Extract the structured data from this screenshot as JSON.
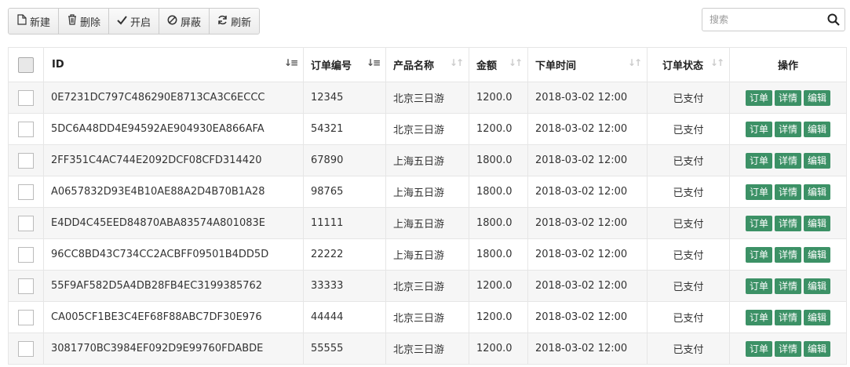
{
  "toolbar": {
    "buttons": [
      {
        "label": "新建",
        "icon": "file-icon"
      },
      {
        "label": "删除",
        "icon": "trash-icon"
      },
      {
        "label": "开启",
        "icon": "check-icon"
      },
      {
        "label": "屏蔽",
        "icon": "ban-icon"
      },
      {
        "label": "刷新",
        "icon": "refresh-icon"
      }
    ]
  },
  "search": {
    "placeholder": "搜索",
    "value": ""
  },
  "table": {
    "columns": [
      "ID",
      "订单编号",
      "产品名称",
      "金额",
      "下单时间",
      "订单状态",
      "操作"
    ],
    "actions": [
      "订单",
      "详情",
      "编辑"
    ],
    "rows": [
      {
        "id": "0E7231DC797C486290E8713CA3C6ECCC",
        "order_no": "12345",
        "product": "北京三日游",
        "amount": "1200.0",
        "time": "2018-03-02 12:00",
        "status": "已支付"
      },
      {
        "id": "5DC6A48DD4E94592AE904930EA866AFA",
        "order_no": "54321",
        "product": "北京三日游",
        "amount": "1200.0",
        "time": "2018-03-02 12:00",
        "status": "已支付"
      },
      {
        "id": "2FF351C4AC744E2092DCF08CFD314420",
        "order_no": "67890",
        "product": "上海五日游",
        "amount": "1800.0",
        "time": "2018-03-02 12:00",
        "status": "已支付"
      },
      {
        "id": "A0657832D93E4B10AE88A2D4B70B1A28",
        "order_no": "98765",
        "product": "上海五日游",
        "amount": "1800.0",
        "time": "2018-03-02 12:00",
        "status": "已支付"
      },
      {
        "id": "E4DD4C45EED84870ABA83574A801083E",
        "order_no": "11111",
        "product": "上海五日游",
        "amount": "1800.0",
        "time": "2018-03-02 12:00",
        "status": "已支付"
      },
      {
        "id": "96CC8BD43C734CC2ACBFF09501B4DD5D",
        "order_no": "22222",
        "product": "上海五日游",
        "amount": "1800.0",
        "time": "2018-03-02 12:00",
        "status": "已支付"
      },
      {
        "id": "55F9AF582D5A4DB28FB4EC3199385762",
        "order_no": "33333",
        "product": "北京三日游",
        "amount": "1200.0",
        "time": "2018-03-02 12:00",
        "status": "已支付"
      },
      {
        "id": "CA005CF1BE3C4EF68F88ABC7DF30E976",
        "order_no": "44444",
        "product": "北京三日游",
        "amount": "1200.0",
        "time": "2018-03-02 12:00",
        "status": "已支付"
      },
      {
        "id": "3081770BC3984EF092D9E99760FDABDE",
        "order_no": "55555",
        "product": "北京三日游",
        "amount": "1200.0",
        "time": "2018-03-02 12:00",
        "status": "已支付"
      }
    ]
  },
  "colors": {
    "action_button": "#3c9166",
    "stripe": "#f6f6f6"
  }
}
